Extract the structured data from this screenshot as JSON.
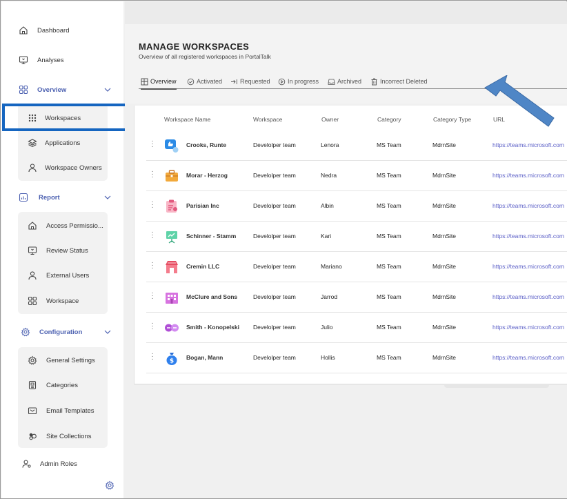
{
  "sidebar": {
    "items": [
      {
        "label": "Dashboard",
        "icon": "home-icon"
      },
      {
        "label": "Analyses",
        "icon": "monitor-icon"
      }
    ],
    "overview": {
      "label": "Overview",
      "children": [
        {
          "label": "Workspaces",
          "icon": "grid-dots-icon"
        },
        {
          "label": "Applications",
          "icon": "layers-icon"
        },
        {
          "label": "Workspace Owners",
          "icon": "person-icon"
        }
      ]
    },
    "report": {
      "label": "Report",
      "children": [
        {
          "label": "Access Permissio...",
          "icon": "home-icon"
        },
        {
          "label": "Review Status",
          "icon": "monitor-icon"
        },
        {
          "label": "External Users",
          "icon": "person-icon"
        },
        {
          "label": "Workspace",
          "icon": "grid-icon"
        }
      ]
    },
    "configuration": {
      "label": "Configuration",
      "children": [
        {
          "label": "General Settings",
          "icon": "gear-icon"
        },
        {
          "label": "Categories",
          "icon": "document-icon"
        },
        {
          "label": "Email Templates",
          "icon": "mail-icon"
        },
        {
          "label": "Site Collections",
          "icon": "site-collection-icon"
        }
      ]
    },
    "admin_roles": {
      "label": "Admin Roles",
      "icon": "person-gear-icon"
    },
    "settings_icon": "gear-icon"
  },
  "page": {
    "title": "MANAGE WORKSPACES",
    "subtitle": "Overview of all registered workspaces in PortalTalk"
  },
  "tabs": [
    {
      "label": "Overview",
      "icon": "overview-icon",
      "active": true
    },
    {
      "label": "Activated",
      "icon": "check-circle-icon",
      "active": false
    },
    {
      "label": "Requested",
      "icon": "arrow-in-icon",
      "active": false
    },
    {
      "label": "In progress",
      "icon": "play-circle-icon",
      "active": false
    },
    {
      "label": "Archived",
      "icon": "archive-icon",
      "active": false
    },
    {
      "label": "Incorrect Deleted",
      "icon": "trash-icon",
      "active": false
    }
  ],
  "table": {
    "columns": [
      "Workspace Name",
      "Workspace",
      "Owner",
      "Category",
      "Category Type",
      "URL"
    ],
    "rows": [
      {
        "name": "Crooks, Runte",
        "workspace": "Develolper team",
        "owner": "Lenora",
        "category": "MS Team",
        "category_type": "MdrnSite",
        "url": "https://teams.microsoft.com",
        "avatar": "thumbs-up-avatar"
      },
      {
        "name": "Morar - Herzog",
        "workspace": "Develolper team",
        "owner": "Nedra",
        "category": "MS Team",
        "category_type": "MdrnSite",
        "url": "https://teams.microsoft.com",
        "avatar": "briefcase-avatar"
      },
      {
        "name": "Parisian Inc",
        "workspace": "Develolper team",
        "owner": "Albin",
        "category": "MS Team",
        "category_type": "MdrnSite",
        "url": "https://teams.microsoft.com",
        "avatar": "clipboard-avatar"
      },
      {
        "name": "Schinner - Stamm",
        "workspace": "Develolper team",
        "owner": "Kari",
        "category": "MS Team",
        "category_type": "MdrnSite",
        "url": "https://teams.microsoft.com",
        "avatar": "presentation-avatar"
      },
      {
        "name": "Cremin LLC",
        "workspace": "Develolper team",
        "owner": "Mariano",
        "category": "MS Team",
        "category_type": "MdrnSite",
        "url": "https://teams.microsoft.com",
        "avatar": "store-avatar"
      },
      {
        "name": "McClure and Sons",
        "workspace": "Develolper team",
        "owner": "Jarrod",
        "category": "MS Team",
        "category_type": "MdrnSite",
        "url": "https://teams.microsoft.com",
        "avatar": "building-avatar"
      },
      {
        "name": "Smith - Konopelski",
        "workspace": "Develolper team",
        "owner": "Julio",
        "category": "MS Team",
        "category_type": "MdrnSite",
        "url": "https://teams.microsoft.com",
        "avatar": "chat-bubbles-avatar"
      },
      {
        "name": "Bogan, Mann",
        "workspace": "Develolper team",
        "owner": "Hollis",
        "category": "MS Team",
        "category_type": "MdrnSite",
        "url": "https://teams.microsoft.com",
        "avatar": "money-bag-avatar"
      }
    ]
  },
  "colors": {
    "accent": "#4a5fb0",
    "highlight_border": "#1565c0",
    "arrow": "#4f86c6",
    "url": "#5b5fc7"
  }
}
